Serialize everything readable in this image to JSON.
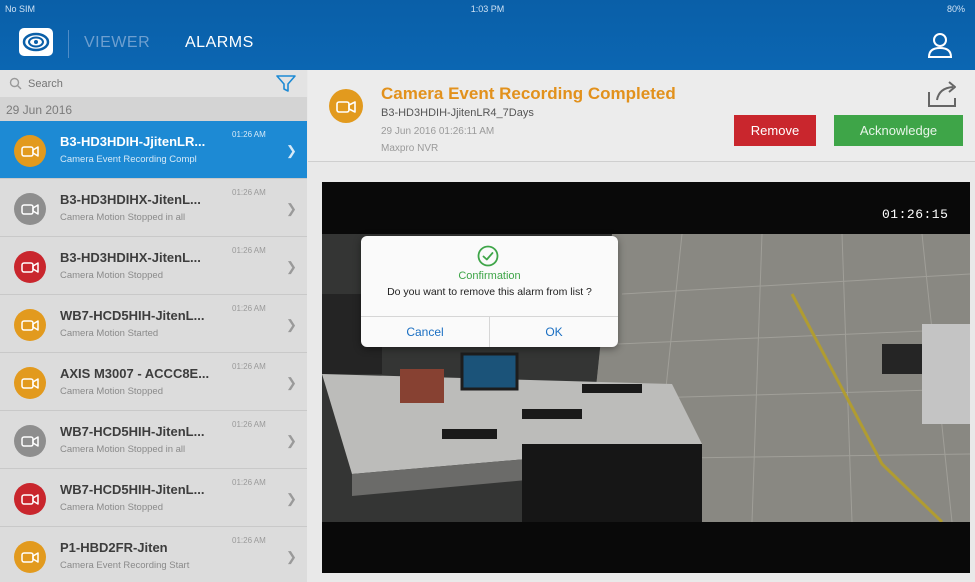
{
  "status_bar": {
    "carrier": "No SIM",
    "time": "1:03 PM",
    "battery": "80%"
  },
  "header": {
    "nav_viewer": "VIEWER",
    "nav_alarms": "ALARMS"
  },
  "search": {
    "placeholder": "Search"
  },
  "list_date": "29 Jun 2016",
  "alarms": [
    {
      "title": "B3-HD3HDIH-JjitenLR...",
      "subtitle": "Camera Event Recording Compl",
      "time": "01:26 AM",
      "color": "#e29a1e",
      "selected": true
    },
    {
      "title": "B3-HD3HDIHX-JitenL...",
      "subtitle": "Camera Motion Stopped in all",
      "time": "01:26 AM",
      "color": "#8e8e8e",
      "selected": false
    },
    {
      "title": "B3-HD3HDIHX-JitenL...",
      "subtitle": "Camera Motion Stopped",
      "time": "01:26 AM",
      "color": "#c9262d",
      "selected": false
    },
    {
      "title": "WB7-HCD5HIH-JitenL...",
      "subtitle": "Camera Motion Started",
      "time": "01:26 AM",
      "color": "#e29a1e",
      "selected": false
    },
    {
      "title": "AXIS M3007 - ACCC8E...",
      "subtitle": "Camera Motion Stopped",
      "time": "01:26 AM",
      "color": "#e29a1e",
      "selected": false
    },
    {
      "title": "WB7-HCD5HIH-JitenL...",
      "subtitle": "Camera Motion Stopped in all",
      "time": "01:26 AM",
      "color": "#8e8e8e",
      "selected": false
    },
    {
      "title": "WB7-HCD5HIH-JitenL...",
      "subtitle": "Camera Motion Stopped",
      "time": "01:26 AM",
      "color": "#c9262d",
      "selected": false
    },
    {
      "title": "P1-HBD2FR-Jiten",
      "subtitle": "Camera Event Recording Start",
      "time": "01:26 AM",
      "color": "#e29a1e",
      "selected": false
    }
  ],
  "detail": {
    "title": "Camera Event Recording Completed",
    "camera_name": "B3-HD3HDIH-JjitenLR4_7Days",
    "datetime": "29 Jun 2016 01:26:11 AM",
    "source": "Maxpro NVR",
    "remove_label": "Remove",
    "acknowledge_label": "Acknowledge"
  },
  "video": {
    "timestamp": "01:26:15"
  },
  "dialog": {
    "title": "Confirmation",
    "message": "Do you want to remove this alarm from list ?",
    "cancel_label": "Cancel",
    "ok_label": "OK"
  }
}
